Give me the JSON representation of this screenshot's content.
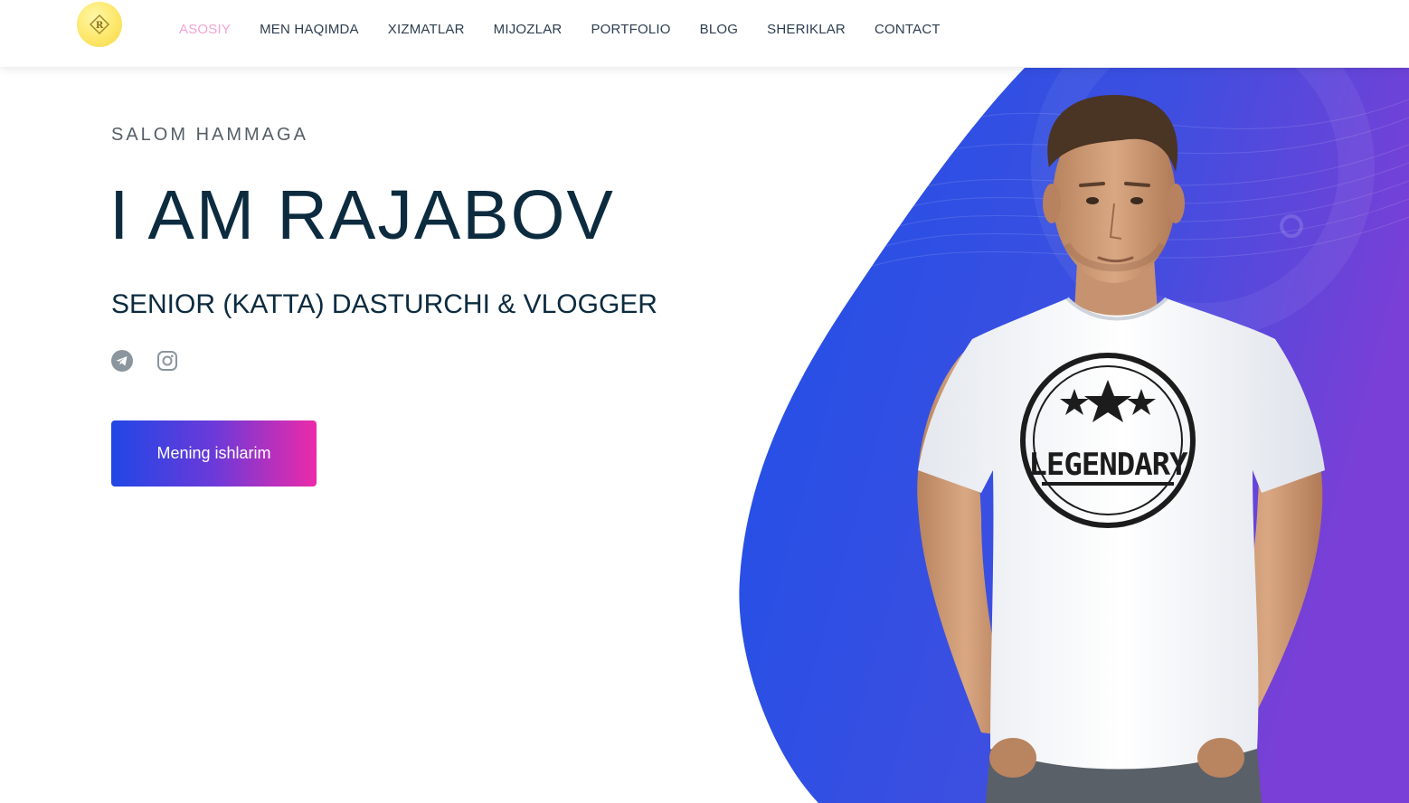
{
  "header": {
    "logo_icon": "brand-logo-icon",
    "nav": [
      {
        "label": "ASOSIY",
        "active": true
      },
      {
        "label": "MEN HAQIMDA",
        "active": false
      },
      {
        "label": "XIZMATLAR",
        "active": false
      },
      {
        "label": "MIJOZLAR",
        "active": false
      },
      {
        "label": "PORTFOLIO",
        "active": false
      },
      {
        "label": "BLOG",
        "active": false
      },
      {
        "label": "SHERIKLAR",
        "active": false
      },
      {
        "label": "CONTACT",
        "active": false
      }
    ]
  },
  "hero": {
    "greeting": "SALOM HAMMAGA",
    "title": "I AM RAJABOV",
    "subtitle": "SENIOR (KATTA) DASTURCHI & VLOGGER",
    "socials": [
      {
        "icon": "telegram-icon"
      },
      {
        "icon": "instagram-icon"
      }
    ],
    "cta_label": "Mening ishlarim",
    "tshirt_text": "LEGENDARY"
  },
  "colors": {
    "nav_active": "#f0a5d6",
    "nav_text": "#2d3e50",
    "heading": "#0c2b3f",
    "gradient_start": "#2047e6",
    "gradient_end": "#ec2aa8",
    "blob_start": "#1f4fe8",
    "blob_end": "#7a3fd6"
  }
}
